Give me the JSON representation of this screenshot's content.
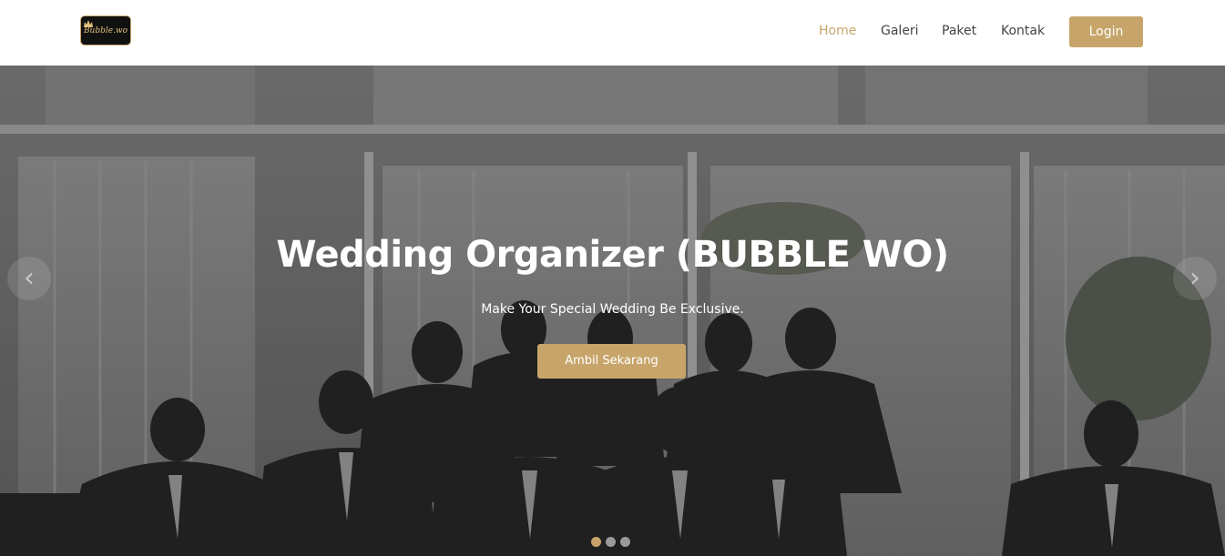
{
  "brand": {
    "logo_text": "Bubble.wo"
  },
  "nav": {
    "links": [
      {
        "label": "Home",
        "active": true
      },
      {
        "label": "Galeri",
        "active": false
      },
      {
        "label": "Paket",
        "active": false
      },
      {
        "label": "Kontak",
        "active": false
      }
    ],
    "login_label": "Login"
  },
  "hero": {
    "title": "Wedding Organizer (BUBBLE WO)",
    "subtitle": "Make Your Special Wedding Be Exclusive.",
    "cta_label": "Ambil Sekarang",
    "prev_icon": "‹",
    "next_icon": "›",
    "slides_count": 3,
    "active_slide": 1
  },
  "colors": {
    "accent": "#c7a56a",
    "nav_text": "#444444",
    "white": "#ffffff"
  },
  "icons": {
    "prev": "chevron-left-icon",
    "next": "chevron-right-icon",
    "logo": "crown-icon"
  }
}
